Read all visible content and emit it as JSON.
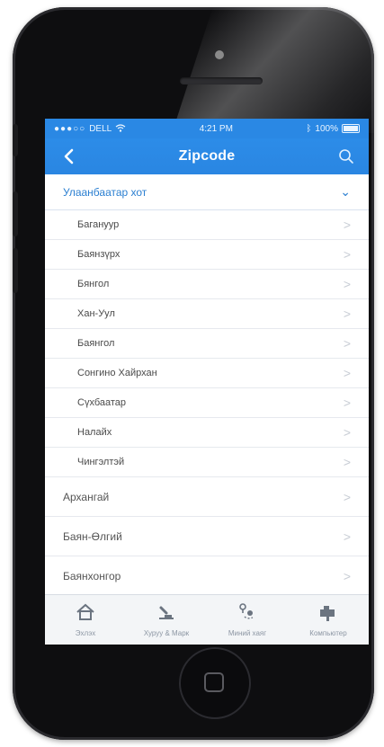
{
  "status_bar": {
    "carrier": "DELL",
    "time": "4:21 PM",
    "battery": "100%"
  },
  "nav_bar": {
    "title": "Zipcode"
  },
  "expanded_section": {
    "title": "Улаанбаатар хот",
    "items": [
      "Багануур",
      "Баянзүрх",
      "Бянгол",
      "Хан-Уул",
      "Баянгол",
      "Сонгино Хайрхан",
      "Сүхбаатар",
      "Налайх",
      "Чингэлтэй"
    ]
  },
  "regions": [
    "Архангай",
    "Баян-Өлгий",
    "Баянхонгор"
  ],
  "tab_bar": {
    "items": [
      {
        "label": "Эхлэх",
        "icon": "home-icon"
      },
      {
        "label": "Хуруу & Марк",
        "icon": "stamp-icon"
      },
      {
        "label": "Миний хаяг",
        "icon": "location-icon"
      },
      {
        "label": "Компьютер",
        "icon": "mailbox-icon"
      }
    ]
  },
  "colors": {
    "accent": "#2a88e4",
    "background": "#f6f7f9"
  }
}
